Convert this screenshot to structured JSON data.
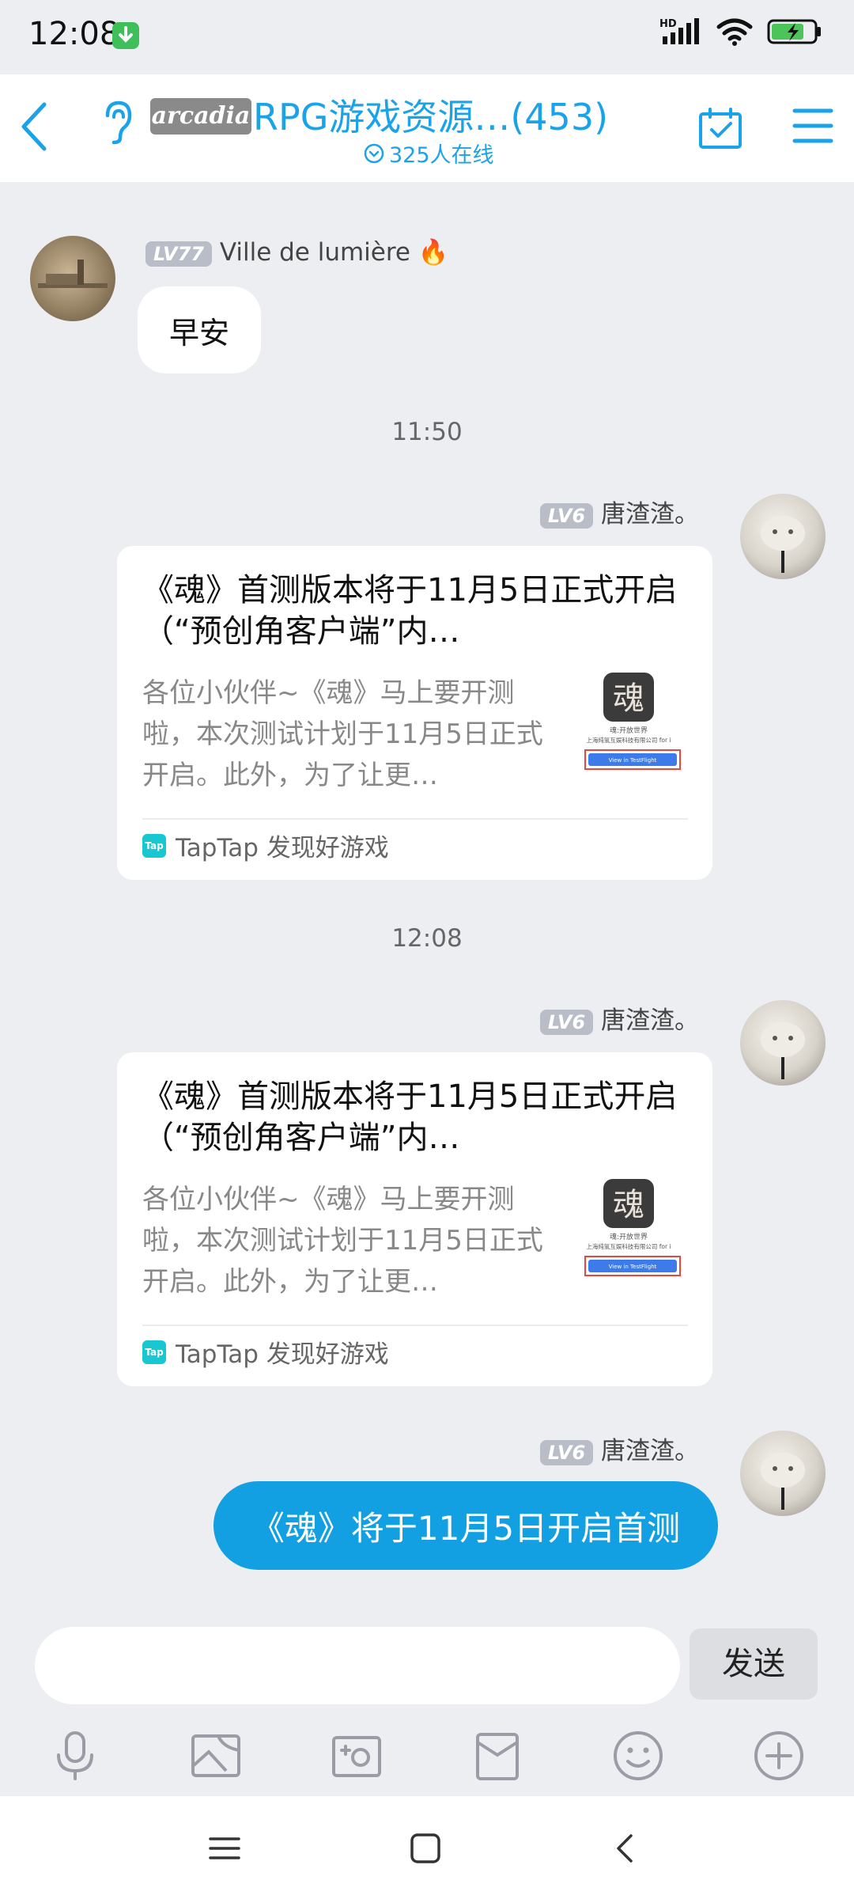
{
  "status_bar": {
    "time": "12:08",
    "signal_label": "HD"
  },
  "header": {
    "brand": "arcadia",
    "title": "RPG游戏资源…(453)",
    "online": "325人在线"
  },
  "messages": [
    {
      "type": "text",
      "side": "left",
      "level": "LV77",
      "sender": "Ville de lumière 🔥",
      "text": "早安"
    },
    {
      "type": "timestamp",
      "text": "11:50"
    },
    {
      "type": "card",
      "side": "right",
      "level": "LV6",
      "sender": "唐渣渣。",
      "title": "《魂》首测版本将于11月5日正式开启（“预创角客户端”内…",
      "desc": "各位小伙伴~《魂》马上要开测啦，本次测试计划于11月5日正式开启。此外，为了让更…",
      "source": "TapTap 发现好游戏"
    },
    {
      "type": "timestamp",
      "text": "12:08"
    },
    {
      "type": "card",
      "side": "right",
      "level": "LV6",
      "sender": "唐渣渣。",
      "title": "《魂》首测版本将于11月5日正式开启（“预创角客户端”内…",
      "desc": "各位小伙伴~《魂》马上要开测啦，本次测试计划于11月5日正式开启。此外，为了让更…",
      "source": "TapTap 发现好游戏"
    },
    {
      "type": "text",
      "side": "right",
      "level": "LV6",
      "sender": "唐渣渣。",
      "text": "《魂》将于11月5日开启首测"
    }
  ],
  "thumb": {
    "glyph": "魂",
    "caption": "魂:开放世界",
    "company": "上海纯氩互娱科技有限公司 for i",
    "button": "View in TestFlight"
  },
  "tap_logo": "Tap",
  "composer": {
    "send_label": "发送"
  },
  "toolbar_icons": [
    "microphone-icon",
    "image-icon",
    "camera-icon",
    "red-packet-icon",
    "emoji-icon",
    "plus-icon"
  ],
  "colors": {
    "accent": "#1AA3E8",
    "bubble_blue": "#13A0E2",
    "background": "#EDEEF2"
  }
}
